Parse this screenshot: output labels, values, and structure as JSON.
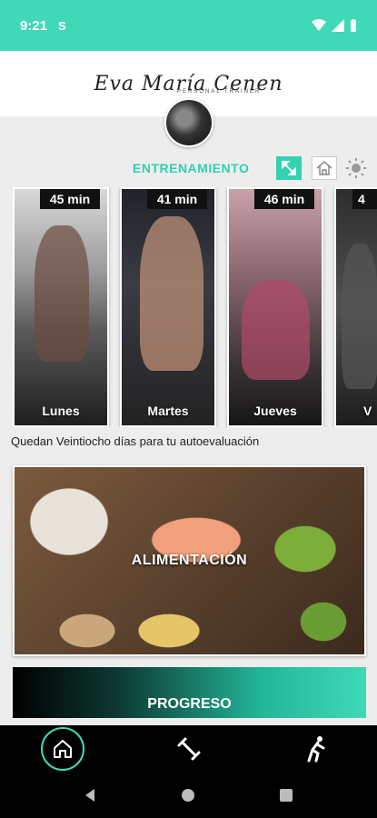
{
  "status_bar": {
    "time": "9:21",
    "notification_glyph": "S"
  },
  "header": {
    "logo_text": "Eva María Cenen",
    "logo_subtitle": "PERSONAL TRAINER"
  },
  "section": {
    "title": "ENTRENAMIENTO"
  },
  "workouts": [
    {
      "duration": "45 min",
      "day": "Lunes"
    },
    {
      "duration": "41 min",
      "day": "Martes"
    },
    {
      "duration": "46 min",
      "day": "Jueves"
    },
    {
      "duration": "4",
      "day": "V"
    }
  ],
  "remaining_text": "Quedan Veintiocho días para tu autoevaluación",
  "food": {
    "label": "ALIMENTACIÓN"
  },
  "progress": {
    "label": "PROGRESO"
  },
  "colors": {
    "accent": "#3fd9b8",
    "section_title": "#2fd1ae"
  },
  "icons": {
    "expand": "expand-icon",
    "home": "home-icon",
    "sun": "sun-icon",
    "nav_home": "home-icon",
    "nav_training": "dumbbell-icon",
    "nav_stretch": "stretch-icon"
  }
}
